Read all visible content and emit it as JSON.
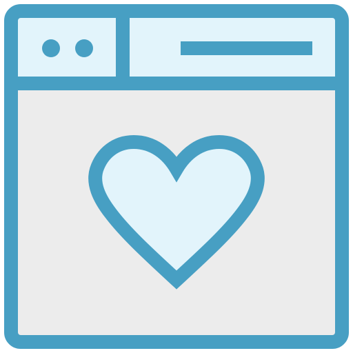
{
  "icon": {
    "name": "browser-favorite-icon",
    "colors": {
      "stroke": "#479fc3",
      "header_fill": "#e2f4fb",
      "body_fill": "#ececec",
      "heart_fill": "#e2f4fb"
    }
  }
}
